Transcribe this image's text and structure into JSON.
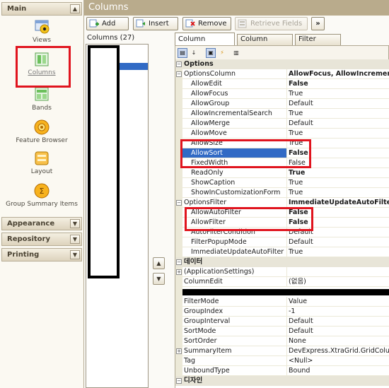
{
  "nav": {
    "groups": [
      {
        "label": "Main",
        "chevron": "▲"
      },
      {
        "label": "Appearance",
        "chevron": "▼"
      },
      {
        "label": "Repository",
        "chevron": "▼"
      },
      {
        "label": "Printing",
        "chevron": "▼"
      }
    ],
    "items": [
      {
        "label": "Views",
        "icon": "views-icon"
      },
      {
        "label": "Columns",
        "icon": "columns-icon"
      },
      {
        "label": "Bands",
        "icon": "bands-icon"
      },
      {
        "label": "Feature Browser",
        "icon": "feature-browser-icon"
      },
      {
        "label": "Layout",
        "icon": "layout-icon"
      },
      {
        "label": "Group Summary Items",
        "icon": "group-summary-icon"
      }
    ]
  },
  "header": {
    "title": "Columns"
  },
  "toolbar": {
    "add": "Add",
    "insert": "Insert",
    "remove": "Remove",
    "retrieve": "Retrieve Fields",
    "more": "»"
  },
  "columns_list": {
    "header": "Columns (27)"
  },
  "move": {
    "up": "▲",
    "down": "▼"
  },
  "tabs": [
    "Column properties",
    "Column options",
    "Filter options"
  ],
  "grid_rows": [
    {
      "type": "cat",
      "name": "Options",
      "pm": "−"
    },
    {
      "type": "top",
      "name": "OptionsColumn",
      "value": "AllowFocus, AllowIncrementalSearch",
      "bold": true,
      "pm": "−"
    },
    {
      "name": "AllowEdit",
      "value": "False",
      "bold": true
    },
    {
      "name": "AllowFocus",
      "value": "True"
    },
    {
      "name": "AllowGroup",
      "value": "Default"
    },
    {
      "name": "AllowIncrementalSearch",
      "value": "True"
    },
    {
      "name": "AllowMerge",
      "value": "Default"
    },
    {
      "name": "AllowMove",
      "value": "True"
    },
    {
      "name": "AllowSize",
      "value": "True"
    },
    {
      "name": "AllowSort",
      "value": "False",
      "bold": true,
      "selected": true
    },
    {
      "name": "FixedWidth",
      "value": "False"
    },
    {
      "name": "ReadOnly",
      "value": "True",
      "bold": true
    },
    {
      "name": "ShowCaption",
      "value": "True"
    },
    {
      "name": "ShowInCustomizationForm",
      "value": "True"
    },
    {
      "type": "top",
      "name": "OptionsFilter",
      "value": "ImmediateUpdateAutoFilter",
      "bold": true,
      "pm": "−"
    },
    {
      "name": "AllowAutoFilter",
      "value": "False",
      "bold": true
    },
    {
      "name": "AllowFilter",
      "value": "False",
      "bold": true
    },
    {
      "name": "AutoFilterCondition",
      "value": "Default"
    },
    {
      "name": "FilterPopupMode",
      "value": "Default"
    },
    {
      "name": "ImmediateUpdateAutoFilter",
      "value": "True"
    },
    {
      "type": "cat",
      "name": "데이터",
      "pm": "−"
    },
    {
      "type": "top",
      "name": "(ApplicationSettings)",
      "value": "",
      "pm": "+"
    },
    {
      "type": "top",
      "name": "ColumnEdit",
      "value": "(없음)"
    },
    {
      "type": "redacted"
    },
    {
      "type": "top",
      "name": "FilterMode",
      "value": "Value"
    },
    {
      "type": "top",
      "name": "GroupIndex",
      "value": "-1"
    },
    {
      "type": "top",
      "name": "GroupInterval",
      "value": "Default"
    },
    {
      "type": "top",
      "name": "SortMode",
      "value": "Default"
    },
    {
      "type": "top",
      "name": "SortOrder",
      "value": "None"
    },
    {
      "type": "top",
      "name": "SummaryItem",
      "value": "DevExpress.XtraGrid.GridColumnSummaryItem",
      "pm": "+"
    },
    {
      "type": "top",
      "name": "Tag",
      "value": "<Null>"
    },
    {
      "type": "top",
      "name": "UnboundType",
      "value": "Bound"
    },
    {
      "type": "cat",
      "name": "디자인",
      "pm": "−"
    }
  ],
  "colors": {
    "highlight": "#e0141e",
    "selection": "#316ac5",
    "title_bar": "#b9ab8c"
  }
}
